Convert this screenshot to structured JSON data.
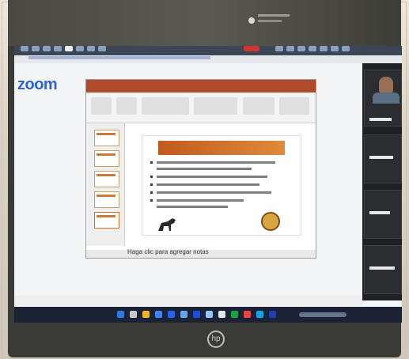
{
  "zoom_logo": "zoom",
  "powerpoint": {
    "notes_placeholder": "Haga clic para agregar notas"
  },
  "colors": {
    "zoom_blue": "#2d62d8",
    "ppt_orange": "#b04a2a",
    "taskbar": "#1a2233"
  },
  "icons": {
    "laptop_brand": "hp-logo-icon",
    "webcam": "camera-icon"
  }
}
